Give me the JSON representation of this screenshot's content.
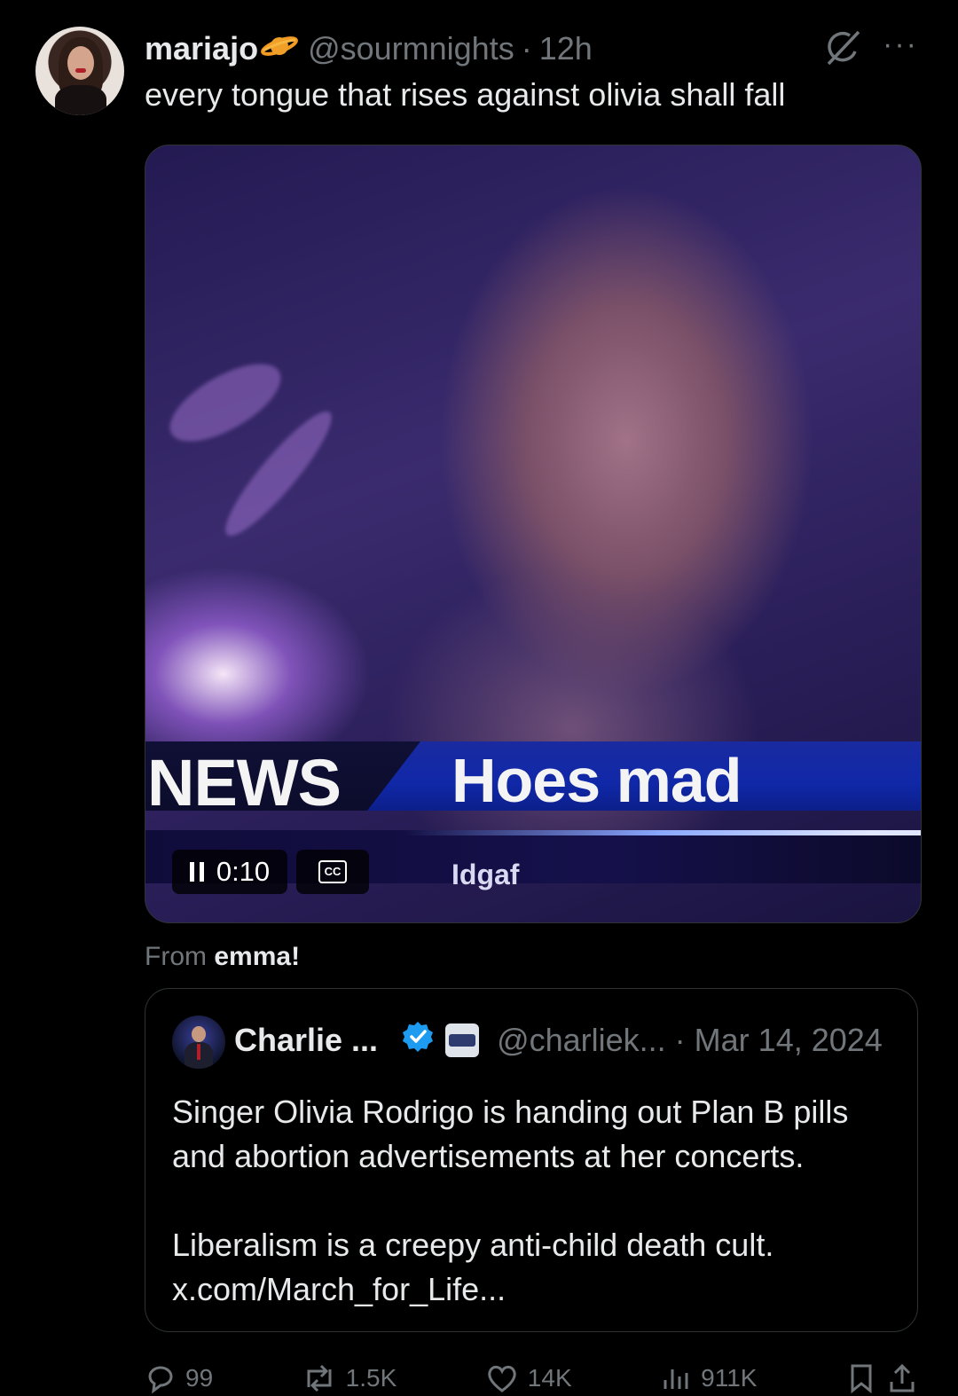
{
  "tweet": {
    "author_name": "mariajo",
    "handle": "@sourmnights",
    "separator": "·",
    "time": "12h",
    "more_label": "···",
    "text": "every tongue that rises against olivia shall fall",
    "video": {
      "banner_left": "NEWS",
      "banner_right": "Hoes mad",
      "ticker": "Idgaf",
      "elapsed": "0:10",
      "cc_label": "CC"
    },
    "from_prefix": "From",
    "from_name": "emma!"
  },
  "quote": {
    "author_name": "Charlie ...",
    "handle": "@charliek...",
    "separator": "·",
    "date": "Mar 14, 2024",
    "lines": [
      "Singer Olivia Rodrigo is handing out Plan B pills and abortion advertisements at her concerts.",
      "Liberalism is a creepy anti-child death cult.",
      "x.com/March_for_Life..."
    ]
  },
  "actions": {
    "replies": "99",
    "reposts": "1.5K",
    "likes": "14K",
    "views": "911K"
  },
  "colors": {
    "background": "#000000",
    "text": "#e7e9ea",
    "muted": "#71767b",
    "verified": "#1d9bf0",
    "border": "#2f3336"
  }
}
